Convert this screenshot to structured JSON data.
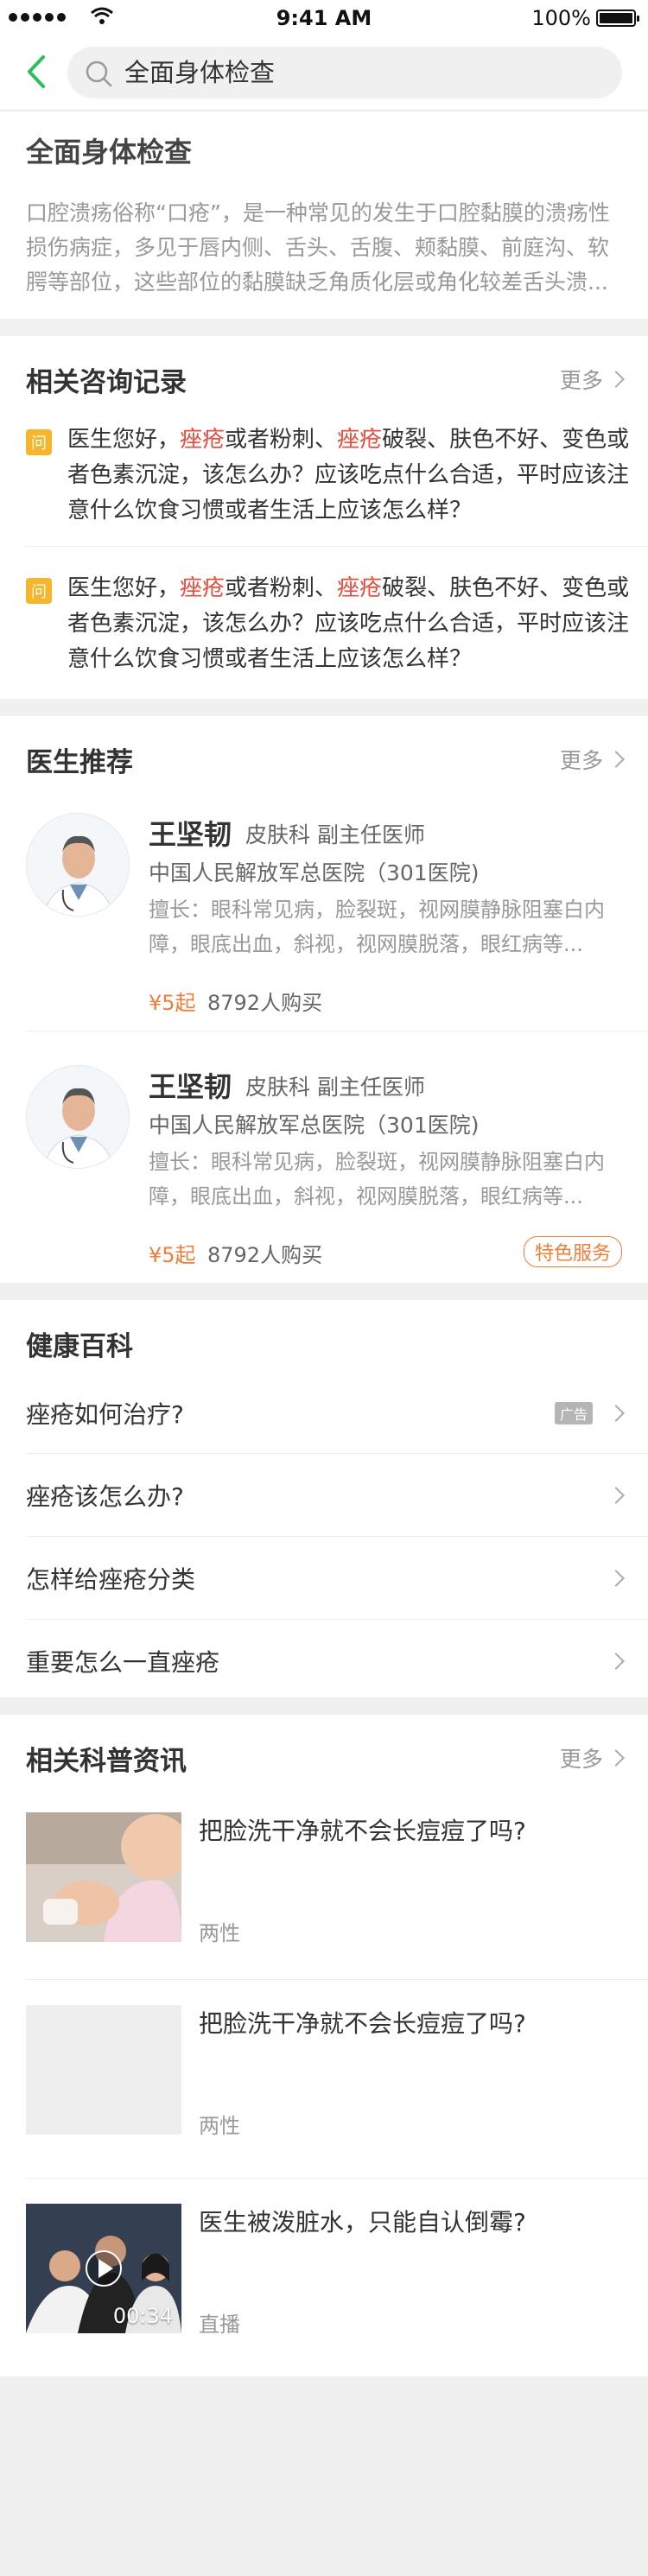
{
  "status_bar": {
    "time": "9:41 AM",
    "battery": "100%"
  },
  "search": {
    "query": "全面身体检查"
  },
  "intro": {
    "title": "全面身体检查",
    "description": "口腔溃疡俗称“口疮”，是一种常见的发生于口腔黏膜的溃疡性损伤病症，多见于唇内侧、舌头、舌腹、颊黏膜、前庭沟、软腭等部位，这些部位的黏膜缺乏角质化层或角化较差舌头溃..."
  },
  "consult": {
    "title": "相关咨询记录",
    "more": "更多",
    "badge": "问",
    "items": [
      {
        "p1": "医生您好，",
        "h1": "痤疮",
        "p2": "或者粉刺、",
        "h2": "痤疮",
        "p3": "破裂、肤色不好、变色或者色素沉淀，该怎么办？应该吃点什么合适，平时应该注意什么饮食习惯或者生活上应该怎么样？"
      },
      {
        "p1": "医生您好，",
        "h1": "痤疮",
        "p2": "或者粉刺、",
        "h2": "痤疮",
        "p3": "破裂、肤色不好、变色或者色素沉淀，该怎么办？应该吃点什么合适，平时应该注意什么饮食习惯或者生活上应该怎么样？"
      }
    ]
  },
  "doctors": {
    "title": "医生推荐",
    "more": "更多",
    "items": [
      {
        "name": "王坚韧",
        "dept": "皮肤科 副主任医师",
        "hospital": "中国人民解放军总医院（301医院)",
        "skill": "擅长：眼科常见病，脸裂斑，视网膜静脉阻塞白内障，眼底出血，斜视，视网膜脱落，眼红病等...",
        "price": "¥5起",
        "bought": "8792人购买",
        "tag": ""
      },
      {
        "name": "王坚韧",
        "dept": "皮肤科 副主任医师",
        "hospital": "中国人民解放军总医院（301医院)",
        "skill": "擅长：眼科常见病，脸裂斑，视网膜静脉阻塞白内障，眼底出血，斜视，视网膜脱落，眼红病等...",
        "price": "¥5起",
        "bought": "8792人购买",
        "tag": "特色服务"
      }
    ]
  },
  "wiki": {
    "title": "健康百科",
    "ad_label": "广告",
    "items": [
      "痤疮如何治疗?",
      "痤疮该怎么办?",
      "怎样给痤疮分类",
      "重要怎么一直痤疮"
    ]
  },
  "news": {
    "title": "相关科普资讯",
    "more": "更多",
    "items": [
      {
        "title": "把脸洗干净就不会长痘痘了吗?",
        "tag": "两性"
      },
      {
        "title": "把脸洗干净就不会长痘痘了吗?",
        "tag": "两性"
      },
      {
        "title": "医生被泼脏水，只能自认倒霉?",
        "tag": "直播",
        "duration": "00:34"
      }
    ]
  },
  "colors": {
    "accent_green": "#2bbf5a",
    "highlight_red": "#e84c3d",
    "price_orange": "#f07d3a",
    "badge_yellow": "#f6b52a"
  }
}
